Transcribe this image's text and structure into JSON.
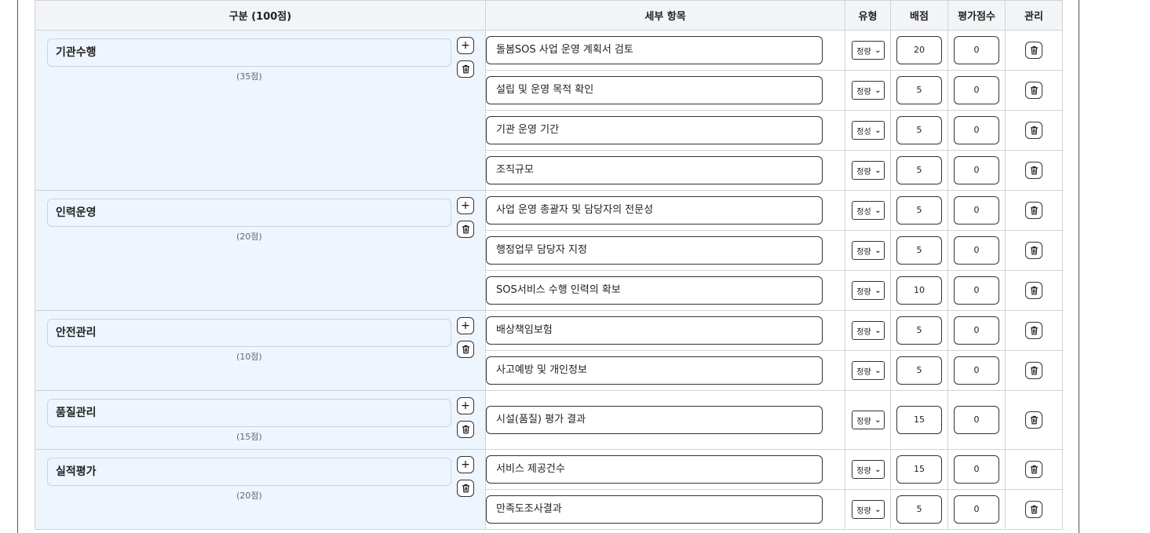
{
  "header": {
    "category": "구분 (100점)",
    "item": "세부 항목",
    "type": "유형",
    "max": "배점",
    "score": "평가점수",
    "manage": "관리"
  },
  "categories": [
    {
      "name": "기관수행",
      "points": "(35점)",
      "items": [
        {
          "label": "돌봄SOS 사업 운영 계획서 검토",
          "type": "정량",
          "max": "20",
          "score": "0"
        },
        {
          "label": "설립 및 운영 목적 확인",
          "type": "정량",
          "max": "5",
          "score": "0"
        },
        {
          "label": "기관 운영 기간",
          "type": "정성",
          "max": "5",
          "score": "0"
        },
        {
          "label": "조직규모",
          "type": "정량",
          "max": "5",
          "score": "0"
        }
      ]
    },
    {
      "name": "인력운영",
      "points": "(20점)",
      "items": [
        {
          "label": "사업 운영 총괄자 및 담당자의 전문성",
          "type": "정성",
          "max": "5",
          "score": "0"
        },
        {
          "label": "행정업무 담당자 지정",
          "type": "정량",
          "max": "5",
          "score": "0"
        },
        {
          "label": "SOS서비스 수행 인력의 확보",
          "type": "정량",
          "max": "10",
          "score": "0"
        }
      ]
    },
    {
      "name": "안전관리",
      "points": "(10점)",
      "items": [
        {
          "label": "배상책임보험",
          "type": "정량",
          "max": "5",
          "score": "0"
        },
        {
          "label": "사고예방 및 개인정보",
          "type": "정량",
          "max": "5",
          "score": "0"
        }
      ]
    },
    {
      "name": "품질관리",
      "points": "(15점)",
      "items": [
        {
          "label": "시설(품질) 평가 결과",
          "type": "정량",
          "max": "15",
          "score": "0"
        }
      ]
    },
    {
      "name": "실적평가",
      "points": "(20점)",
      "items": [
        {
          "label": "서비스 제공건수",
          "type": "정량",
          "max": "15",
          "score": "0"
        },
        {
          "label": "만족도조사결과",
          "type": "정량",
          "max": "5",
          "score": "0"
        }
      ]
    }
  ],
  "icons": {
    "add": "plus-icon",
    "delete": "trash-icon",
    "dropdown": "chevron-down-icon"
  }
}
